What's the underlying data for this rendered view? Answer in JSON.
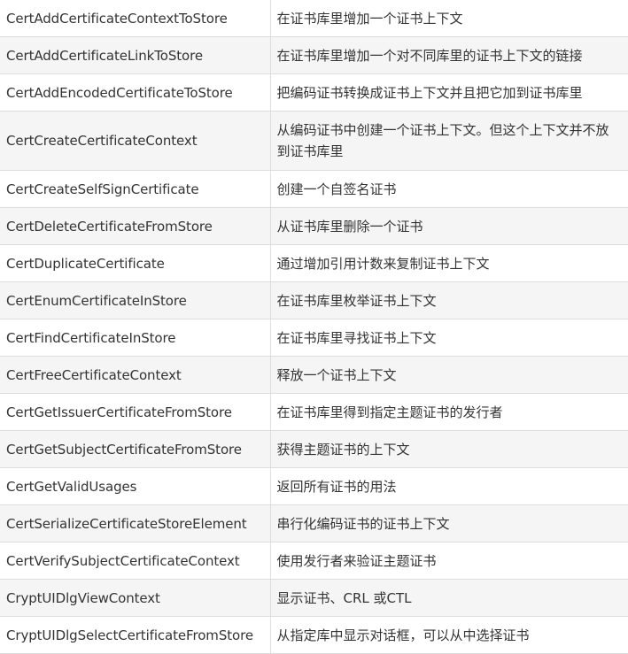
{
  "rows": [
    {
      "fn": "CertAddCertificateContextToStore",
      "desc": "在证书库里增加一个证书上下文"
    },
    {
      "fn": "CertAddCertificateLinkToStore",
      "desc": "在证书库里增加一个对不同库里的证书上下文的链接"
    },
    {
      "fn": "CertAddEncodedCertificateToStore",
      "desc": "把编码证书转换成证书上下文并且把它加到证书库里"
    },
    {
      "fn": "CertCreateCertificateContext",
      "desc": "从编码证书中创建一个证书上下文。但这个上下文并不放到证书库里"
    },
    {
      "fn": "CertCreateSelfSignCertificate",
      "desc": "创建一个自签名证书"
    },
    {
      "fn": "CertDeleteCertificateFromStore",
      "desc": "从证书库里删除一个证书"
    },
    {
      "fn": "CertDuplicateCertificate",
      "desc": "通过增加引用计数来复制证书上下文"
    },
    {
      "fn": "CertEnumCertificateInStore",
      "desc": "在证书库里枚举证书上下文"
    },
    {
      "fn": "CertFindCertificateInStore",
      "desc": "在证书库里寻找证书上下文"
    },
    {
      "fn": "CertFreeCertificateContext",
      "desc": "释放一个证书上下文"
    },
    {
      "fn": "CertGetIssuerCertificateFromStore",
      "desc": "在证书库里得到指定主题证书的发行者"
    },
    {
      "fn": "CertGetSubjectCertificateFromStore",
      "desc": "获得主题证书的上下文"
    },
    {
      "fn": "CertGetValidUsages",
      "desc": "返回所有证书的用法"
    },
    {
      "fn": "CertSerializeCertificateStoreElement",
      "desc": "串行化编码证书的证书上下文"
    },
    {
      "fn": "CertVerifySubjectCertificateContext",
      "desc": "使用发行者来验证主题证书"
    },
    {
      "fn": "CryptUIDlgViewContext",
      "desc": "显示证书、CRL 或CTL"
    },
    {
      "fn": "CryptUIDlgSelectCertificateFromStore",
      "desc": "从指定库中显示对话框，可以从中选择证书"
    }
  ]
}
